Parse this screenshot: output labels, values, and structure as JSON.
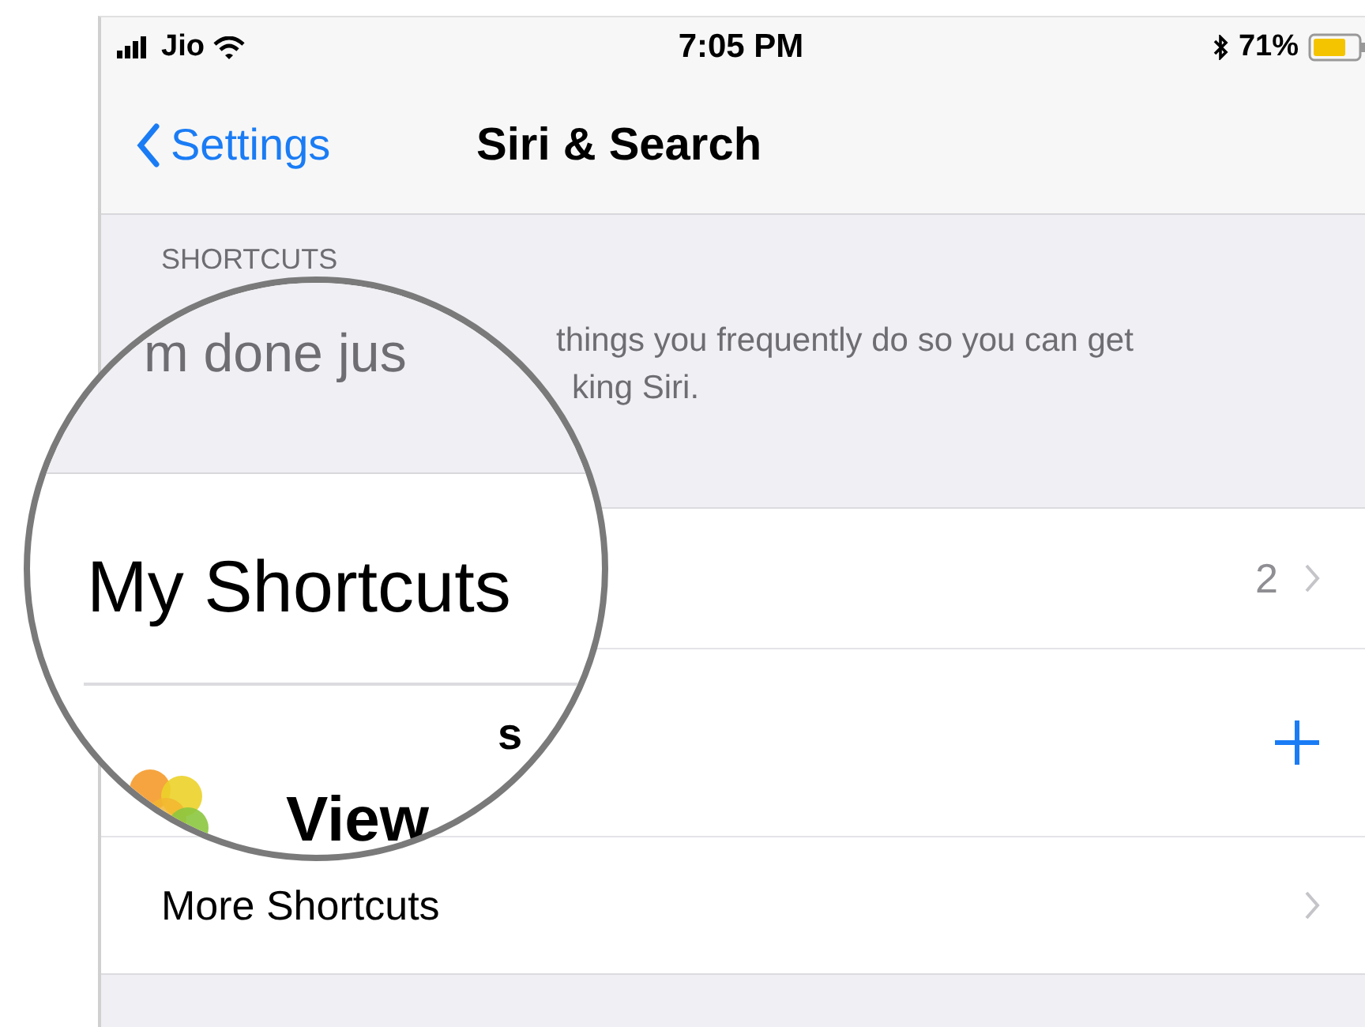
{
  "status_bar": {
    "carrier": "Jio",
    "time": "7:05 PM",
    "battery": "71%"
  },
  "nav_bar": {
    "back": "Settings",
    "title": "Siri & Search"
  },
  "section": {
    "header": "SHORTCUTS",
    "footer_lines": [
      "things you frequently do so you can get",
      "king Siri."
    ]
  },
  "rows": [
    {
      "kind": "count",
      "value": "2"
    },
    {
      "kind": "add"
    },
    {
      "kind": "link",
      "label": "More Shortcuts"
    }
  ],
  "magnifier": {
    "footer_fragment": "m done jus",
    "row_label": "My Shortcuts",
    "fragment": "s",
    "item_label": "View"
  }
}
